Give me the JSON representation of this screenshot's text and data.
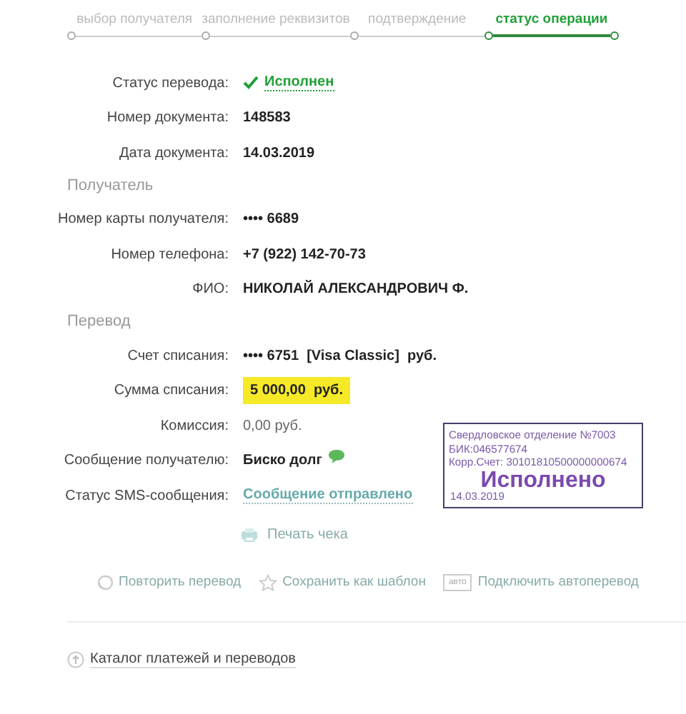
{
  "steps": [
    {
      "label": "выбор получателя",
      "selected": false
    },
    {
      "label": "заполнение реквизитов",
      "selected": false
    },
    {
      "label": "подтверждение",
      "selected": false
    },
    {
      "label": "статус операции",
      "selected": true
    }
  ],
  "sections": [
    {
      "rows": [
        {
          "label": "Статус перевода:",
          "value": "Исполнен",
          "kind": "status"
        },
        {
          "label": "Номер документа:",
          "value": "148583",
          "kind": "bold"
        },
        {
          "label": "Дата документа:",
          "value": "14.03.2019",
          "kind": "bold"
        }
      ]
    },
    {
      "title": "Получатель",
      "rows": [
        {
          "label": "Номер карты получателя:",
          "value": "•••• 6689",
          "kind": "bold"
        },
        {
          "label": "Номер телефона:",
          "value": "+7 (922) 142-70-73",
          "kind": "bold"
        },
        {
          "label": "ФИО:",
          "value": "НИКОЛАЙ АЛЕКСАНДРОВИЧ Ф.",
          "kind": "bold"
        }
      ]
    },
    {
      "title": "Перевод",
      "rows": [
        {
          "label": "Счет списания:",
          "value": "•••• 6751  [Visa Classic]  руб.",
          "kind": "bold"
        },
        {
          "label": "Сумма списания:",
          "value": "5 000,00  руб.",
          "kind": "highlight"
        },
        {
          "label": "Комиссия:",
          "value": "0,00 руб.",
          "kind": "plain"
        },
        {
          "label": "Сообщение получателю:",
          "value": "Биско долг",
          "kind": "message"
        },
        {
          "label": "Статус SMS-сообщения:",
          "value": "Сообщение отправлено",
          "kind": "link"
        }
      ]
    }
  ],
  "print_link": "Печать чека",
  "actions": [
    {
      "label": "Повторить перевод",
      "kind": "repeat"
    },
    {
      "label": "Сохранить как шаблон",
      "kind": "star"
    },
    {
      "label": "Подключить автоперевод",
      "kind": "auto",
      "badge": "авто"
    }
  ],
  "catalog_link": "Каталог платежей и переводов",
  "stamp": {
    "lines": [
      "Свердловское отделение №7003",
      "БИК:046577674",
      "Корр.Счет: 30101810500000000674"
    ],
    "title": "Исполнено",
    "date": "14.03.2019"
  }
}
